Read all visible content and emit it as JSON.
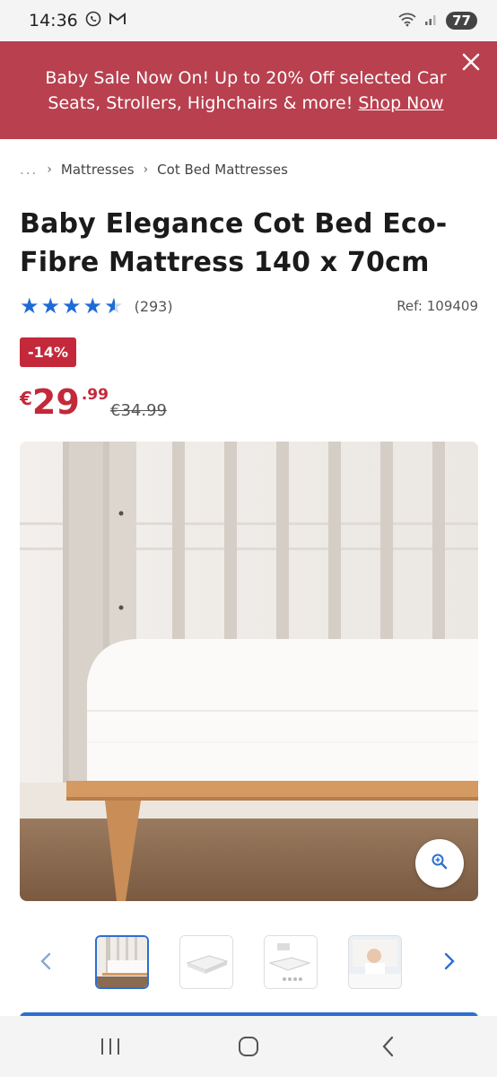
{
  "status_bar": {
    "time": "14:36",
    "battery": "77"
  },
  "promo": {
    "text": "Baby Sale Now On! Up to 20% Off selected Car Seats, Strollers, Highchairs & more!",
    "link": "Shop Now"
  },
  "breadcrumb": {
    "ellipsis": "...",
    "items": [
      "Mattresses",
      "Cot Bed Mattresses"
    ]
  },
  "product": {
    "title": "Baby Elegance Cot Bed Eco-Fibre Mattress 140 x 70cm",
    "rating": 4.5,
    "review_count": "(293)",
    "ref": "Ref: 109409",
    "discount": "-14%",
    "price_currency": "€",
    "price_whole": "29",
    "price_cents": ".99",
    "old_price": "€34.99"
  },
  "gallery": {
    "thumbnail_count": 4,
    "active_index": 0
  },
  "colors": {
    "promo_bg": "#b8404f",
    "sale_red": "#c3293a",
    "star_blue": "#1f6bd6",
    "accent_blue": "#2d6fd0"
  },
  "icons": {
    "close": "close-icon",
    "zoom": "zoom-in-icon",
    "prev": "chevron-left-icon",
    "next": "chevron-right-icon"
  }
}
